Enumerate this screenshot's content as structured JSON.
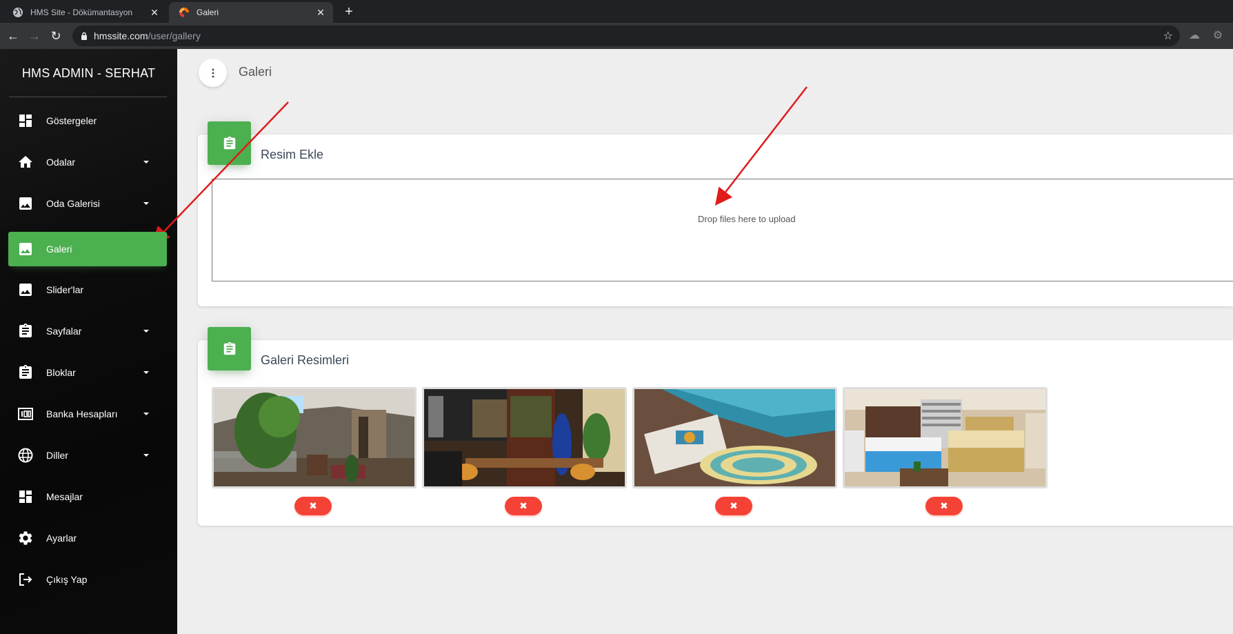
{
  "browser": {
    "tabs": [
      {
        "title": "HMS Site - Dökümantasyon",
        "active": false
      },
      {
        "title": "Galeri",
        "active": true
      }
    ],
    "url_host": "hmssite.com",
    "url_path": "/user/gallery"
  },
  "sidebar": {
    "brand": "HMS ADMIN - SERHAT",
    "items": [
      {
        "label": "Göstergeler",
        "icon": "dashboard-icon",
        "caret": false,
        "active": false
      },
      {
        "label": "Odalar",
        "icon": "home-icon",
        "caret": true,
        "active": false
      },
      {
        "label": "Oda Galerisi",
        "icon": "image-icon",
        "caret": true,
        "active": false
      },
      {
        "label": "Galeri",
        "icon": "image-icon",
        "caret": false,
        "active": true
      },
      {
        "label": "Slider'lar",
        "icon": "image-icon",
        "caret": false,
        "active": false
      },
      {
        "label": "Sayfalar",
        "icon": "clipboard-icon",
        "caret": true,
        "active": false
      },
      {
        "label": "Bloklar",
        "icon": "clipboard-icon",
        "caret": true,
        "active": false
      },
      {
        "label": "Banka Hesapları",
        "icon": "bank-icon",
        "caret": true,
        "active": false
      },
      {
        "label": "Diller",
        "icon": "globe-icon",
        "caret": true,
        "active": false
      },
      {
        "label": "Mesajlar",
        "icon": "dashboard-icon",
        "caret": false,
        "active": false
      },
      {
        "label": "Ayarlar",
        "icon": "gear-icon",
        "caret": false,
        "active": false
      },
      {
        "label": "Çıkış Yap",
        "icon": "logout-icon",
        "caret": false,
        "active": false
      }
    ]
  },
  "main": {
    "page_title": "Galeri",
    "upload_card": {
      "title": "Resim Ekle",
      "dropzone_text": "Drop files here to upload"
    },
    "gallery_card": {
      "title": "Galeri Resimleri",
      "images": [
        {
          "scene": "hotel-lobby",
          "delete_label": "✖"
        },
        {
          "scene": "hotel-bar",
          "delete_label": "✖"
        },
        {
          "scene": "pool-deck",
          "delete_label": "✖"
        },
        {
          "scene": "hotel-room",
          "delete_label": "✖"
        }
      ]
    }
  },
  "colors": {
    "accent": "#4caf50",
    "danger": "#f44336",
    "annotation": "#e01b1b"
  }
}
